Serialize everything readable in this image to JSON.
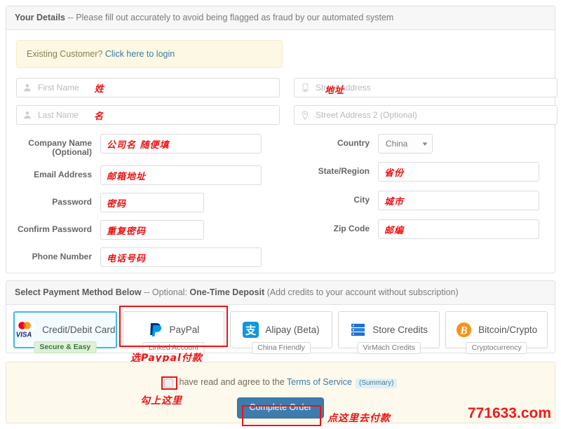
{
  "details": {
    "header_title": "Your Details",
    "header_sep": " -- ",
    "header_note": "Please fill out accurately to avoid being flagged as fraud by our automated system",
    "login_note_prefix": "Existing Customer? ",
    "login_note_link": "Click here to login",
    "fields": {
      "first_name": {
        "placeholder": "First Name",
        "annotation": "姓",
        "icon": "user-icon"
      },
      "last_name": {
        "placeholder": "Last Name",
        "annotation": "名",
        "icon": "user-icon"
      },
      "company_name": {
        "label": "Company Name",
        "label_sub": "(Optional)",
        "annotation": "公司名 随便填"
      },
      "email_address": {
        "label": "Email Address",
        "annotation": "邮箱地址"
      },
      "password": {
        "label": "Password",
        "annotation": "密码"
      },
      "confirm_password": {
        "label": "Confirm Password",
        "annotation": "重复密码"
      },
      "phone_number": {
        "label": "Phone Number",
        "annotation": "电话号码"
      },
      "street_address": {
        "placeholder": "Street Address",
        "annotation": "地址",
        "icon": "building-icon"
      },
      "street_address_2": {
        "placeholder": "Street Address 2 (Optional)",
        "icon": "map-pin-icon"
      },
      "country": {
        "label": "Country",
        "value": "China"
      },
      "state_region": {
        "label": "State/Region",
        "annotation": "省份"
      },
      "city": {
        "label": "City",
        "annotation": "城市"
      },
      "zip_code": {
        "label": "Zip Code",
        "annotation": "邮编"
      }
    }
  },
  "payment": {
    "header_title": "Select Payment Method Below",
    "header_sep": " -- ",
    "header_optional": "Optional: ",
    "header_strong": "One-Time Deposit",
    "header_tail": " (Add credits to your account without subscription)",
    "methods": [
      {
        "label": "Credit/Debit Card",
        "badge": "Secure & Easy",
        "icon": "mastercard-visa-icon",
        "selected": true,
        "marked": false
      },
      {
        "label": "PayPal",
        "badge": "Linked Account",
        "icon": "paypal-icon",
        "selected": false,
        "marked": true
      },
      {
        "label": "Alipay (Beta)",
        "badge": "China Friendly",
        "icon": "alipay-icon",
        "selected": false,
        "marked": false
      },
      {
        "label": "Store Credits",
        "badge": "VirMach Credits",
        "icon": "server-stack-icon",
        "selected": false,
        "marked": false
      },
      {
        "label": "Bitcoin/Crypto",
        "badge": "Cryptocurrency",
        "icon": "bitcoin-icon",
        "selected": false,
        "marked": false
      }
    ],
    "annotation": "选Paypal付款"
  },
  "agree": {
    "text_prefix": "have read and agree to the ",
    "tos_link": "Terms of Service",
    "summary_pill": "(Summary)",
    "annotation": "勾上这里",
    "submit_label": "Complete Order",
    "submit_annotation": "点这里去付款"
  },
  "watermark": "771633.com",
  "colors": {
    "accent_blue": "#3e7cad",
    "marker_red": "#ee1111",
    "selected_border": "#41b6f0",
    "note_bg": "#fcf8e3",
    "agree_bg": "#fdf9ed"
  }
}
